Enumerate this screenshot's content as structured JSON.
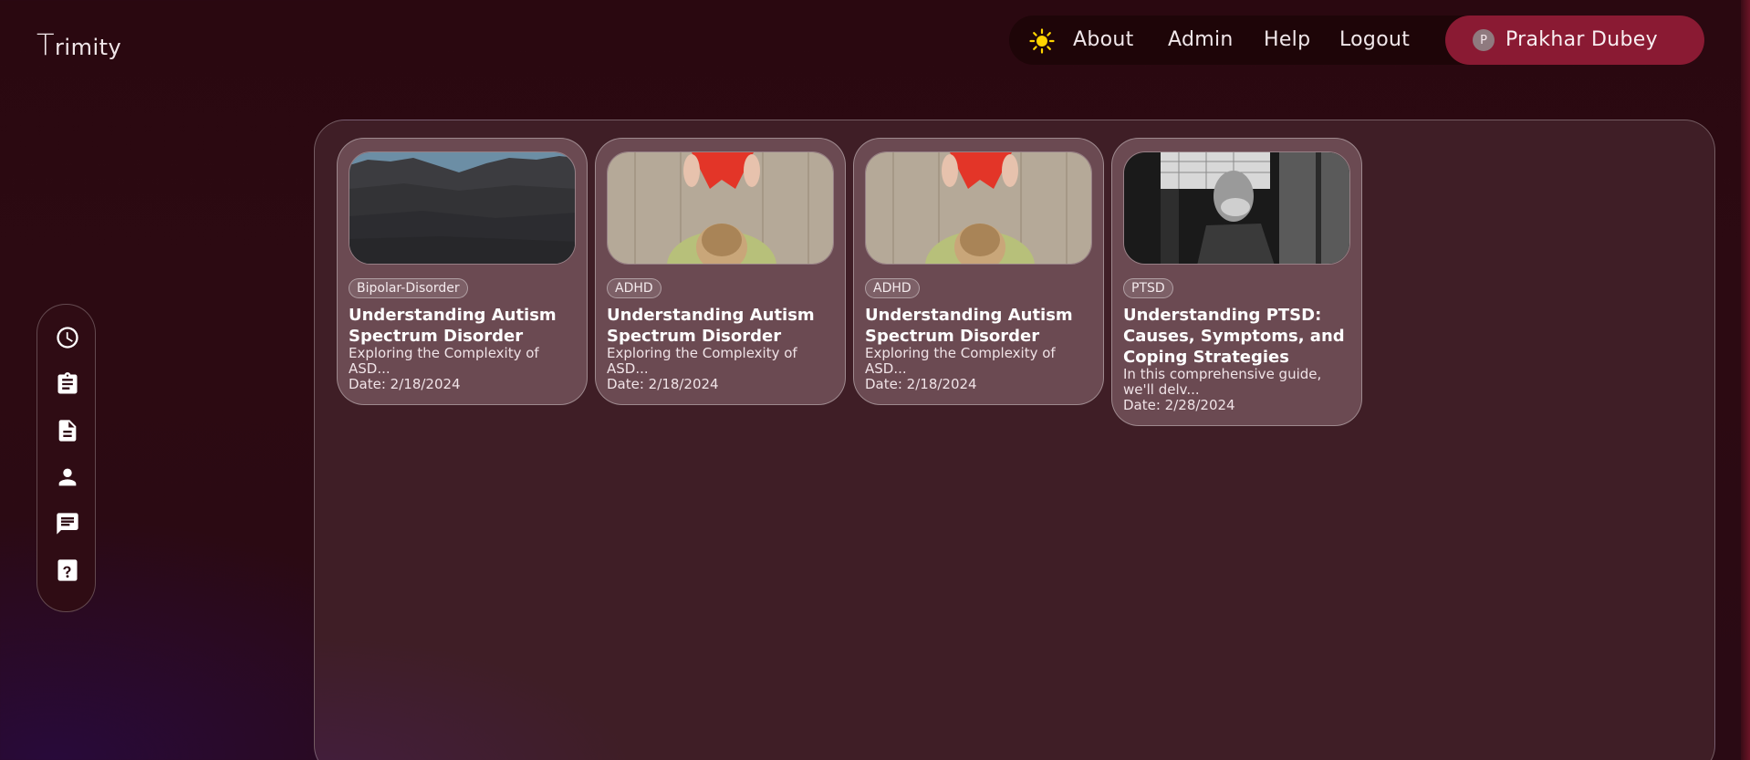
{
  "app": {
    "logo_initial": "T",
    "logo_rest": "rimity"
  },
  "nav": {
    "theme_icon": "sun-icon",
    "links": [
      "About",
      "Admin",
      "Help",
      "Logout"
    ],
    "user": {
      "avatar_initial": "P",
      "name": "Prakhar Dubey"
    }
  },
  "sidebar": {
    "items": [
      {
        "icon": "clock-icon"
      },
      {
        "icon": "clipboard-icon"
      },
      {
        "icon": "document-icon"
      },
      {
        "icon": "person-icon"
      },
      {
        "icon": "chat-icon"
      },
      {
        "icon": "help-icon"
      }
    ]
  },
  "cards": [
    {
      "image": "rocky-cliff-image",
      "tag": "Bipolar-Disorder",
      "title": "Understanding Autism Spectrum Disorder",
      "desc": "Exploring the Complexity of ASD...",
      "date": "Date: 2/18/2024"
    },
    {
      "image": "child-with-red-paper-image",
      "tag": "ADHD",
      "title": "Understanding Autism Spectrum Disorder",
      "desc": "Exploring the Complexity of ASD...",
      "date": "Date: 2/18/2024"
    },
    {
      "image": "child-with-red-paper-image",
      "tag": "ADHD",
      "title": "Understanding Autism Spectrum Disorder",
      "desc": "Exploring the Complexity of ASD...",
      "date": "Date: 2/18/2024"
    },
    {
      "image": "masked-person-image",
      "tag": "PTSD",
      "title": "Understanding PTSD: Causes, Symptoms, and Coping Strategies",
      "desc": "In this comprehensive guide, we'll delv...",
      "date": "Date: 2/28/2024"
    }
  ],
  "colors": {
    "background": "#2a0810",
    "nav_bg": "#1e0508",
    "user_pill": "#8a1a33",
    "panel": "#3f1e26",
    "card": "#6b4a52",
    "sun": "#ffd400"
  }
}
